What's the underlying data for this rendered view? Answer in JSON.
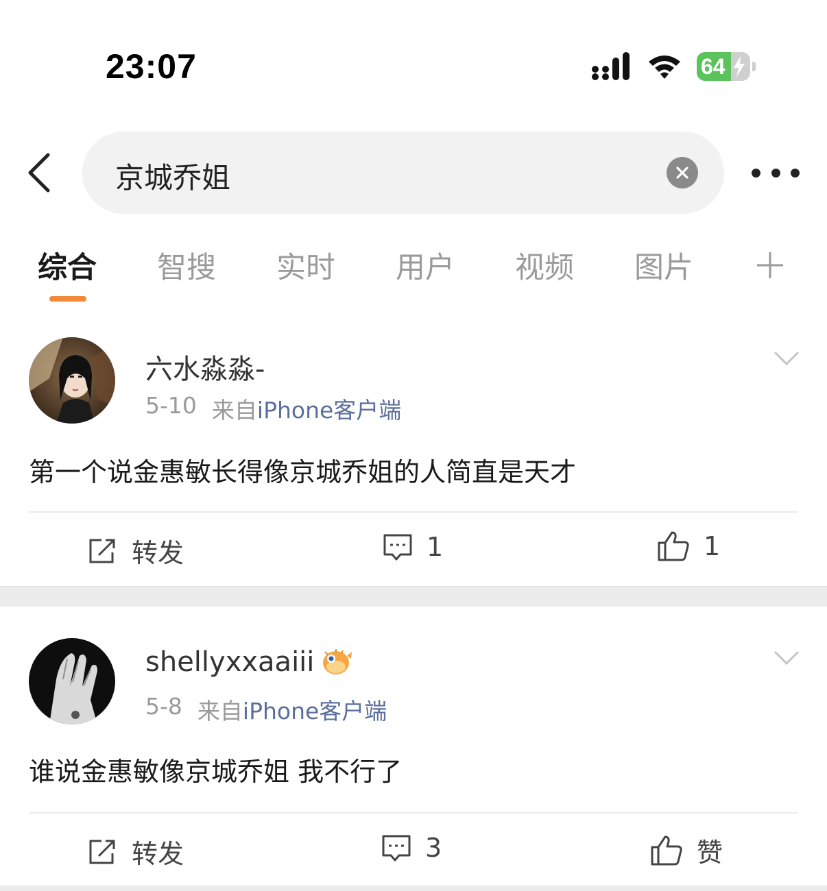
{
  "status_bar": {
    "time": "23:07",
    "battery": "64",
    "battery_level_percent": 64,
    "icons": [
      "signal-icon",
      "wifi-icon",
      "battery-icon",
      "charging-bolt-icon"
    ]
  },
  "search": {
    "query": "京城乔姐",
    "icons": [
      "back-arrow-icon",
      "clear-icon",
      "more-icon"
    ]
  },
  "tabs": {
    "items": [
      {
        "label": "综合",
        "active": true
      },
      {
        "label": "智搜",
        "active": false
      },
      {
        "label": "实时",
        "active": false
      },
      {
        "label": "用户",
        "active": false
      },
      {
        "label": "视频",
        "active": false
      },
      {
        "label": "图片",
        "active": false
      }
    ],
    "add_icon": "plus-icon",
    "indicator_color": "#f08a3a"
  },
  "posts": [
    {
      "username": "六水淼淼-",
      "date": "5-10",
      "source_prefix": "来自",
      "source_device": "iPhone客户端",
      "text": "第一个说金惠敏长得像京城乔姐的人简直是天才",
      "repost_label": "转发",
      "comment_count": "1",
      "like_label": "1"
    },
    {
      "username": "shellyxxaaiii",
      "badge_icon": "pufferfish-badge-icon",
      "date": "5-8",
      "source_prefix": "来自",
      "source_device": "iPhone客户端",
      "text": "谁说金惠敏像京城乔姐 我不行了",
      "repost_label": "转发",
      "comment_count": "3",
      "like_label": "赞"
    }
  ],
  "colors": {
    "source_link": "#5b6f9c",
    "battery_green": "#5cc35c",
    "separator": "#ececec"
  }
}
